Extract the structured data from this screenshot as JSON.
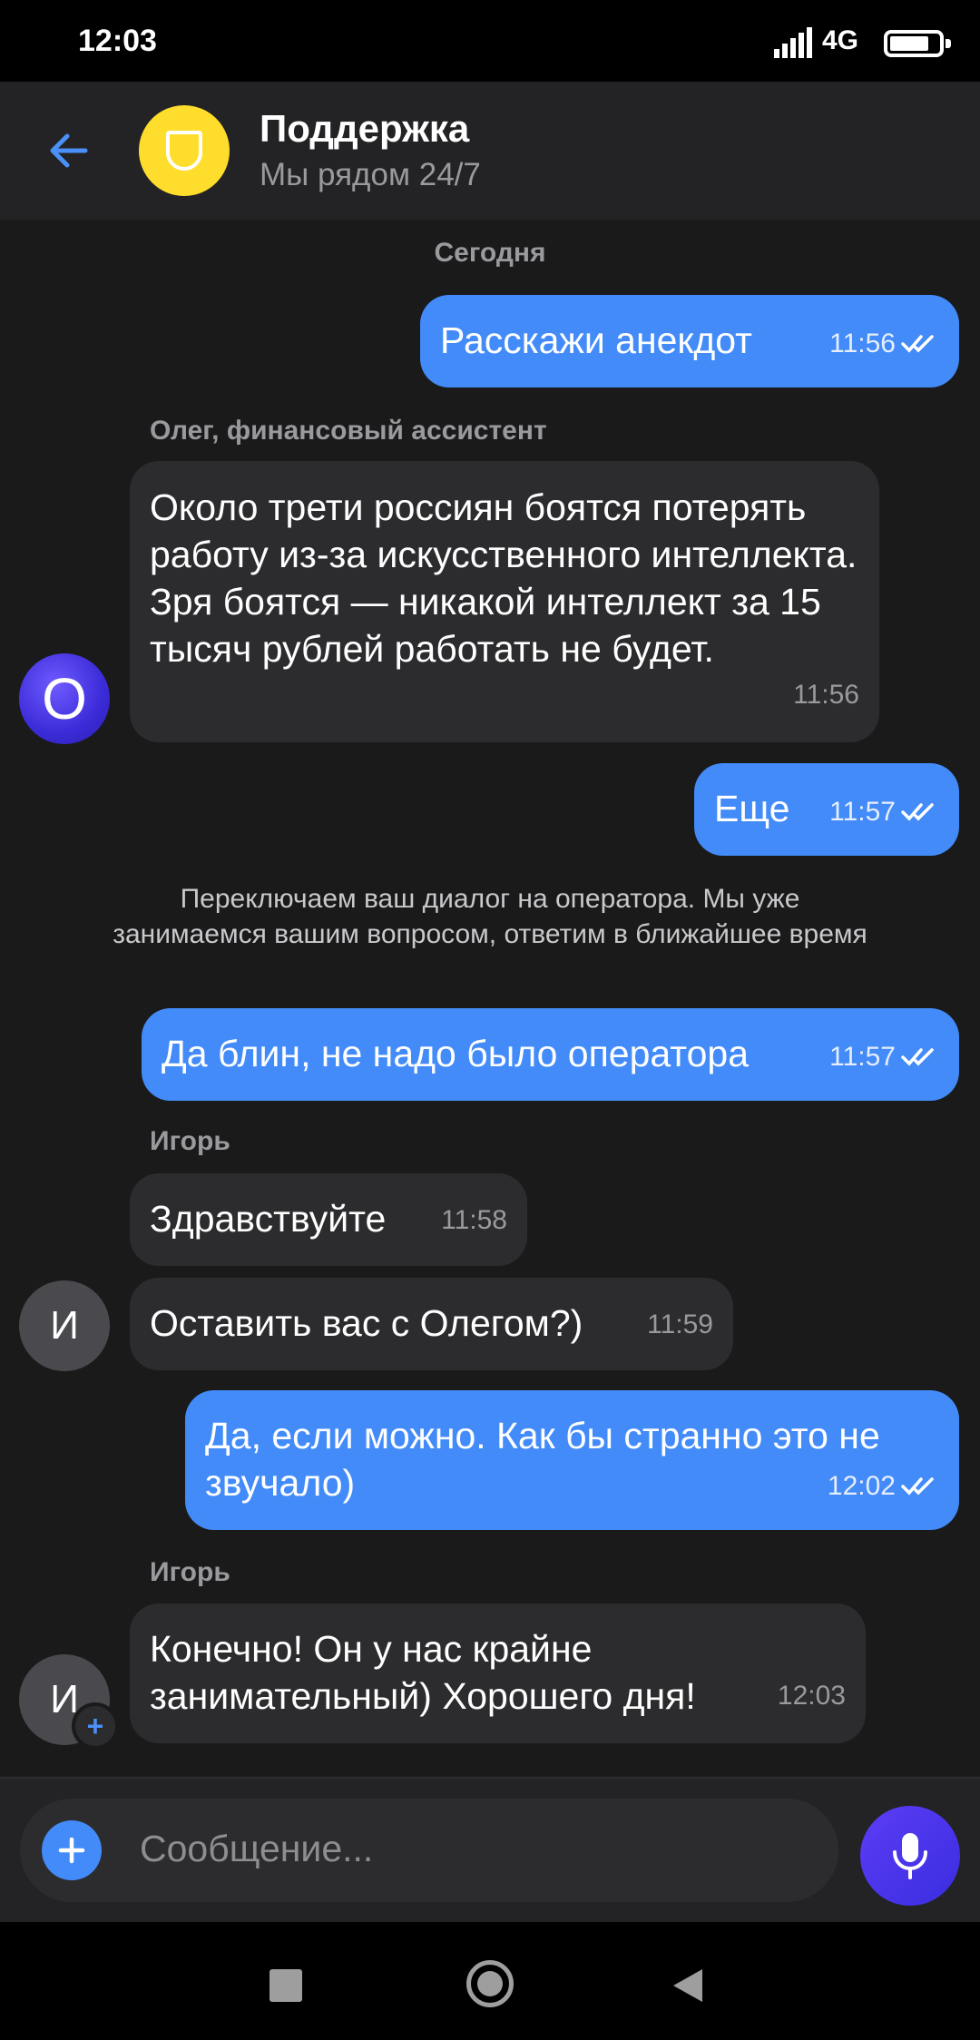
{
  "status_bar": {
    "time": "12:03",
    "network": "4G",
    "battery_level": 0.75,
    "icons": [
      "signal-icon",
      "battery-icon"
    ]
  },
  "header": {
    "title": "Поддержка",
    "subtitle": "Мы рядом 24/7",
    "logo_icon": "bank-crest-icon",
    "logo_color": "#ffdd2d"
  },
  "chat": {
    "date_separator": "Сегодня",
    "messages": [
      {
        "id": "m1",
        "dir": "out",
        "text": "Расскажи анекдот",
        "time": "11:56",
        "read": true
      },
      {
        "id": "m2",
        "dir": "in",
        "sender": "Олег, финансовый ассистент",
        "text": "Около трети россиян боятся потерять работу из-за искусственного интеллекта. Зря боятся — никакой интеллект за 15 тысяч рублей работать не будет.",
        "time": "11:56",
        "avatar": "О"
      },
      {
        "id": "m3",
        "dir": "out",
        "text": "Еще",
        "time": "11:57",
        "read": true
      },
      {
        "id": "m4",
        "dir": "system",
        "text": "Переключаем ваш диалог на оператора. Мы уже занимаемся вашим вопросом, ответим в ближайшее время"
      },
      {
        "id": "m5",
        "dir": "out",
        "text": "Да блин, не надо было оператора",
        "time": "11:57",
        "read": true
      },
      {
        "id": "m6",
        "dir": "in",
        "sender": "Игорь",
        "text": "Здравствуйте",
        "time": "11:58"
      },
      {
        "id": "m7",
        "dir": "in",
        "text": "Оставить вас с Олегом?)",
        "time": "11:59",
        "avatar": "И"
      },
      {
        "id": "m8",
        "dir": "out",
        "text": "Да, если можно. Как бы странно это не звучало)",
        "time": "12:02",
        "read": true
      },
      {
        "id": "m9",
        "dir": "in",
        "sender": "Игорь",
        "text": "Конечно! Он у нас крайне занимательный) Хорошего дня!",
        "time": "12:03",
        "avatar": "И"
      }
    ]
  },
  "input": {
    "placeholder": "Сообщение..."
  },
  "colors": {
    "outgoing_bubble": "#428bf9",
    "incoming_bubble": "#2c2c2e",
    "background": "#1a1a1b",
    "mic_button": "#4a35ea"
  },
  "nav": {
    "icons": [
      "recent-apps-icon",
      "home-icon",
      "back-nav-icon"
    ]
  }
}
